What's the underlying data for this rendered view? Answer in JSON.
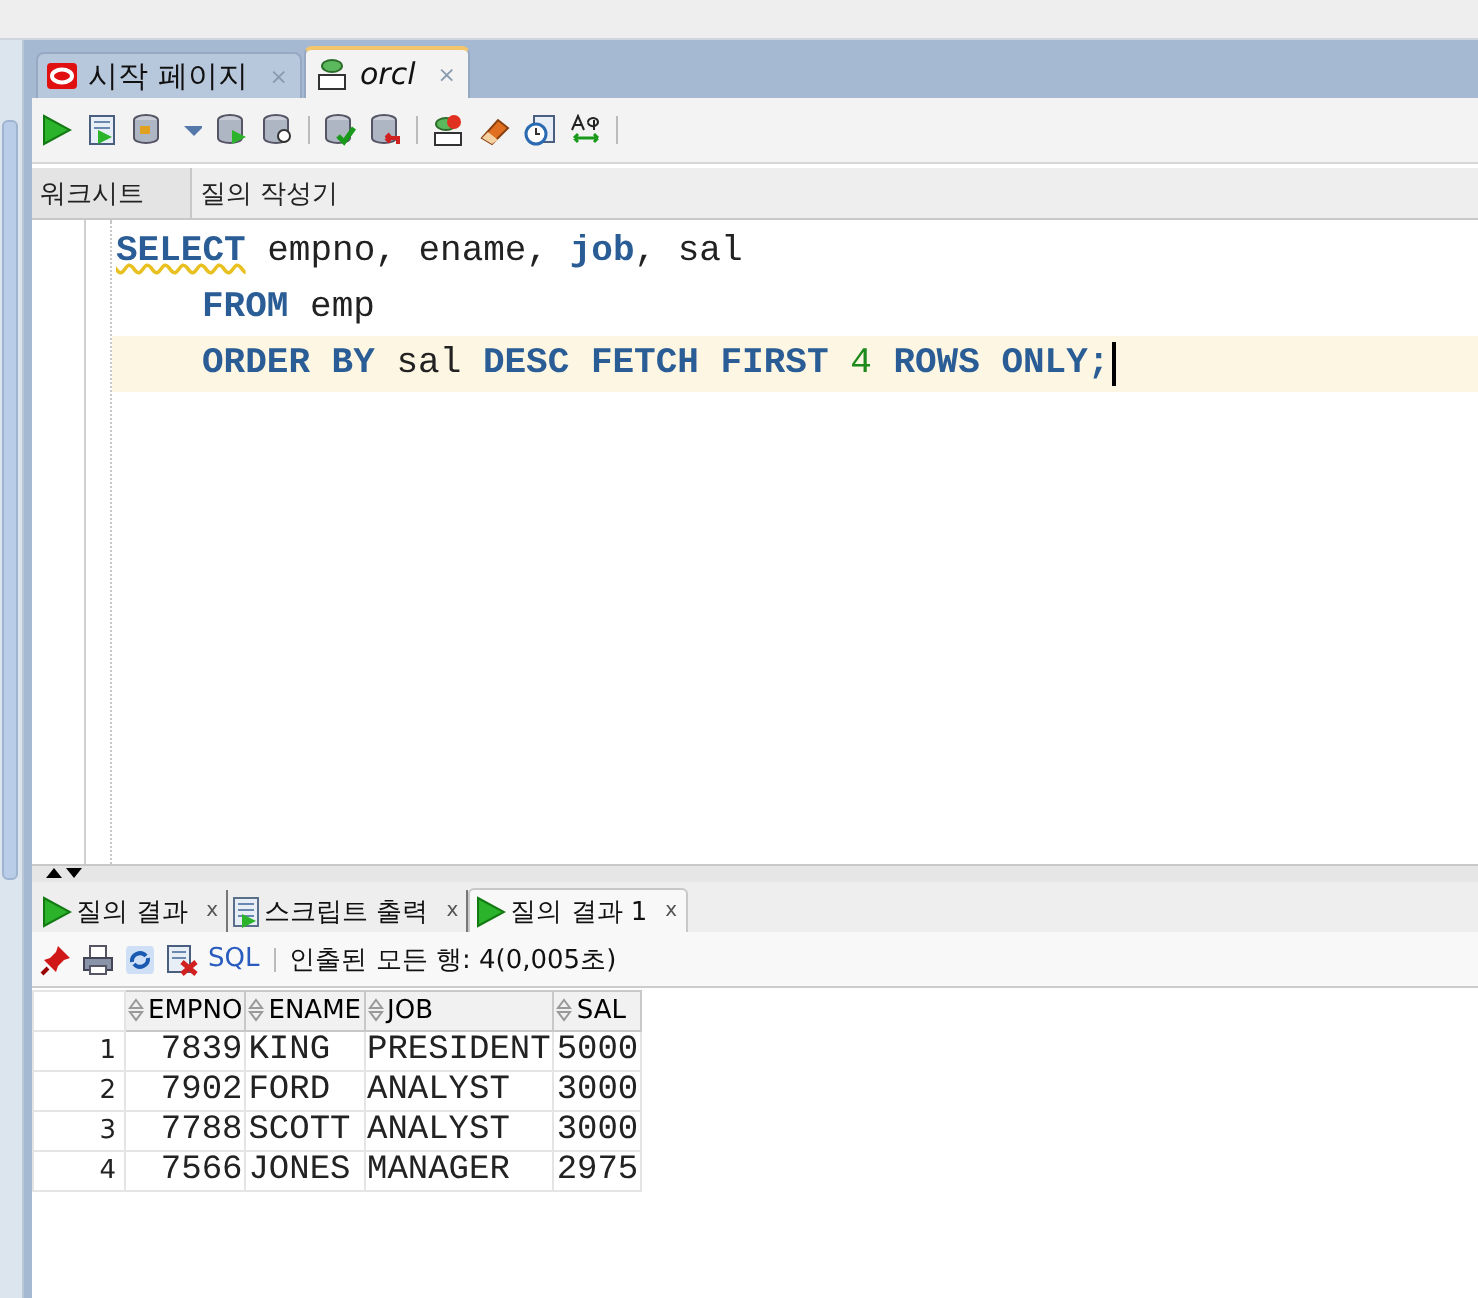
{
  "doc_tabs": [
    {
      "label": "시작 페이지",
      "kind": "start",
      "selected": false,
      "close": "×"
    },
    {
      "label": "orcl",
      "kind": "sql",
      "selected": true,
      "close": "×"
    }
  ],
  "sub_tabs": [
    {
      "label": "워크시트",
      "selected": true
    },
    {
      "label": "질의 작성기",
      "selected": false
    }
  ],
  "editor": {
    "lines": [
      {
        "indent": false,
        "current": false,
        "tokens": [
          {
            "text": "SELECT",
            "kind": "keyword",
            "warning": true
          },
          {
            "text": " empno, ename, ",
            "kind": "plain",
            "warning": false
          },
          {
            "text": "job",
            "kind": "keyword",
            "warning": false
          },
          {
            "text": ", sal",
            "kind": "plain",
            "warning": false
          }
        ]
      },
      {
        "indent": true,
        "current": false,
        "tokens": [
          {
            "text": "FROM",
            "kind": "keyword",
            "warning": false
          },
          {
            "text": " emp",
            "kind": "plain",
            "warning": false
          }
        ]
      },
      {
        "indent": true,
        "current": true,
        "tokens": [
          {
            "text": "ORDER BY",
            "kind": "keyword",
            "warning": false
          },
          {
            "text": " sal ",
            "kind": "plain",
            "warning": false
          },
          {
            "text": "DESC FETCH FIRST ",
            "kind": "keyword",
            "warning": false
          },
          {
            "text": "4",
            "kind": "number",
            "warning": false
          },
          {
            "text": " ROWS ONLY;",
            "kind": "keyword",
            "warning": false
          }
        ]
      }
    ]
  },
  "result_tabs": [
    {
      "label": "질의 결과",
      "kind": "run",
      "selected": false,
      "close": "x"
    },
    {
      "label": "스크립트 출력",
      "kind": "script",
      "selected": false,
      "close": "x"
    },
    {
      "label": "질의 결과 1",
      "kind": "run",
      "selected": true,
      "close": "x"
    }
  ],
  "result_toolbar": {
    "sql_link": "SQL",
    "status": "인출된 모든 행: 4(0,005초)"
  },
  "table": {
    "columns": [
      "EMPNO",
      "ENAME",
      "JOB",
      "SAL"
    ],
    "rows": [
      {
        "number": "1",
        "cells": [
          "7839",
          "KING",
          "PRESIDENT",
          "5000"
        ]
      },
      {
        "number": "2",
        "cells": [
          "7902",
          "FORD",
          "ANALYST",
          "3000"
        ]
      },
      {
        "number": "3",
        "cells": [
          "7788",
          "SCOTT",
          "ANALYST",
          "3000"
        ]
      },
      {
        "number": "4",
        "cells": [
          "7566",
          "JONES",
          "MANAGER",
          "2975"
        ]
      }
    ]
  }
}
